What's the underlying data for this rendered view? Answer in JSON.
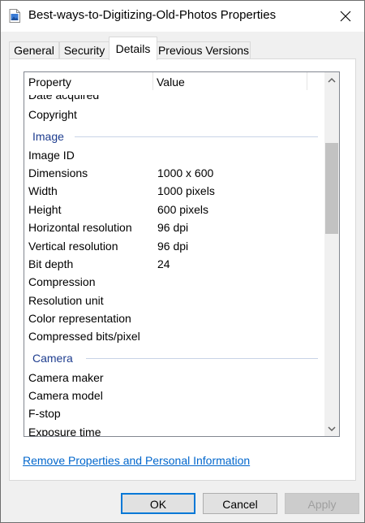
{
  "window": {
    "title": "Best-ways-to-Digitizing-Old-Photos Properties"
  },
  "tabs": [
    {
      "label": "General"
    },
    {
      "label": "Security"
    },
    {
      "label": "Details"
    },
    {
      "label": "Previous Versions"
    }
  ],
  "list": {
    "headers": {
      "property": "Property",
      "value": "Value"
    },
    "partial_row": "Date acquired",
    "rows_top": [
      {
        "label": "Copyright",
        "value": ""
      }
    ],
    "groups": [
      {
        "name": "Image",
        "rows": [
          {
            "label": "Image ID",
            "value": ""
          },
          {
            "label": "Dimensions",
            "value": "1000 x 600"
          },
          {
            "label": "Width",
            "value": "1000 pixels"
          },
          {
            "label": "Height",
            "value": "600 pixels"
          },
          {
            "label": "Horizontal resolution",
            "value": "96 dpi"
          },
          {
            "label": "Vertical resolution",
            "value": "96 dpi"
          },
          {
            "label": "Bit depth",
            "value": "24"
          },
          {
            "label": "Compression",
            "value": ""
          },
          {
            "label": "Resolution unit",
            "value": ""
          },
          {
            "label": "Color representation",
            "value": ""
          },
          {
            "label": "Compressed bits/pixel",
            "value": ""
          }
        ]
      },
      {
        "name": "Camera",
        "rows": [
          {
            "label": "Camera maker",
            "value": ""
          },
          {
            "label": "Camera model",
            "value": ""
          },
          {
            "label": "F-stop",
            "value": ""
          },
          {
            "label": "Exposure time",
            "value": ""
          }
        ]
      }
    ]
  },
  "link": "Remove Properties and Personal Information",
  "buttons": {
    "ok": "OK",
    "cancel": "Cancel",
    "apply": "Apply"
  },
  "colors": {
    "accent": "#0078d7",
    "group_heading": "#1e3d8f",
    "link": "#0066cc"
  }
}
